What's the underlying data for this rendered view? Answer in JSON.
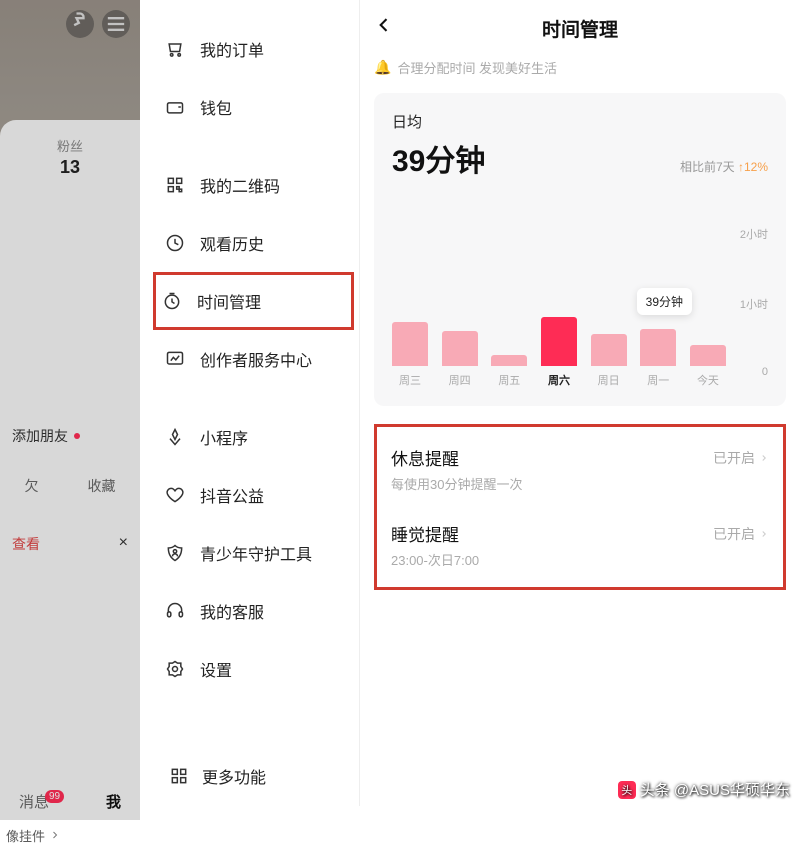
{
  "left": {
    "fans_label": "粉丝",
    "fans_count": "13",
    "add_friend": "添加朋友",
    "tab_like": "欠",
    "tab_collect": "收藏",
    "view_label": "查看",
    "close_x": "×",
    "avatar_hang": "像挂件",
    "nav_msg": "消息",
    "nav_msg_badge": "99",
    "nav_me": "我"
  },
  "menu": {
    "items": [
      {
        "label": "我的订单",
        "icon": "cart-icon"
      },
      {
        "label": "钱包",
        "icon": "wallet-icon"
      },
      {
        "label": "我的二维码",
        "icon": "qr-icon"
      },
      {
        "label": "观看历史",
        "icon": "history-icon"
      },
      {
        "label": "时间管理",
        "icon": "clock-icon",
        "highlighted": true
      },
      {
        "label": "创作者服务中心",
        "icon": "chart-icon"
      },
      {
        "label": "小程序",
        "icon": "miniapp-icon"
      },
      {
        "label": "抖音公益",
        "icon": "heart-icon"
      },
      {
        "label": "青少年守护工具",
        "icon": "shield-icon"
      },
      {
        "label": "我的客服",
        "icon": "support-icon"
      },
      {
        "label": "设置",
        "icon": "gear-icon"
      }
    ],
    "more": "更多功能"
  },
  "right": {
    "title": "时间管理",
    "subtitle": "合理分配时间 发现美好生活",
    "avg_label": "日均",
    "avg_value": "39分钟",
    "compare_prefix": "相比前7天",
    "compare_value": "12%",
    "y_labels": {
      "h2": "2小时",
      "h1": "1小时",
      "zero": "0"
    },
    "tooltip": "39分钟",
    "settings": [
      {
        "title": "休息提醒",
        "status": "已开启",
        "desc": "每使用30分钟提醒一次"
      },
      {
        "title": "睡觉提醒",
        "status": "已开启",
        "desc": "23:00-次日7:00"
      }
    ]
  },
  "chart_data": {
    "type": "bar",
    "categories": [
      "周三",
      "周四",
      "周五",
      "周六",
      "周日",
      "周一",
      "今天"
    ],
    "values": [
      35,
      28,
      9,
      39,
      26,
      30,
      17
    ],
    "unit": "分钟",
    "title": "日均 39分钟",
    "xlabel": "",
    "ylabel": "",
    "ylim": [
      0,
      120
    ],
    "highlighted_index": 3,
    "y_ticks": [
      0,
      60,
      120
    ],
    "y_tick_labels": [
      "0",
      "1小时",
      "2小时"
    ]
  },
  "watermark": "头条 @ASUS华硕华东"
}
